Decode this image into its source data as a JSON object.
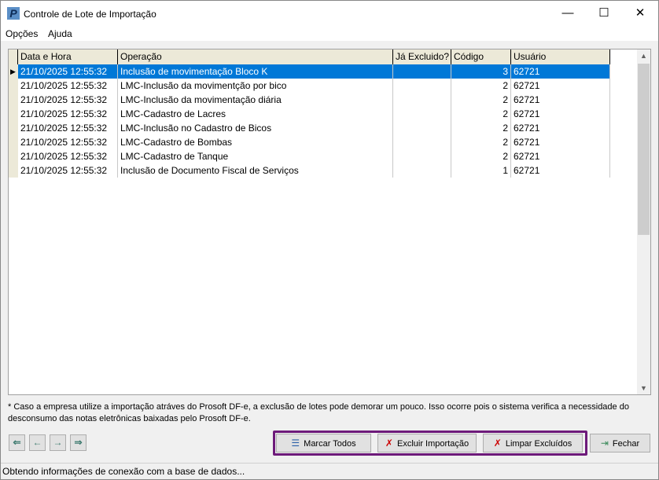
{
  "window": {
    "title": "Controle de Lote de Importação",
    "minimize": "—",
    "maximize": "☐",
    "close": "✕"
  },
  "menu": [
    "Opções",
    "Ajuda"
  ],
  "table": {
    "columns": [
      "Data e Hora",
      "Operação",
      "Já Excluido?",
      "Código",
      "Usuário"
    ],
    "rows": [
      {
        "data": "21/10/2025 12:55:32",
        "operacao": "Inclusão de movimentação Bloco K",
        "excluido": "",
        "codigo": "3",
        "usuario": "62721",
        "selected": true
      },
      {
        "data": "21/10/2025 12:55:32",
        "operacao": "LMC-Inclusão da movimentção por bico",
        "excluido": "",
        "codigo": "2",
        "usuario": "62721"
      },
      {
        "data": "21/10/2025 12:55:32",
        "operacao": "LMC-Inclusão da movimentação diária",
        "excluido": "",
        "codigo": "2",
        "usuario": "62721"
      },
      {
        "data": "21/10/2025 12:55:32",
        "operacao": "LMC-Cadastro de Lacres",
        "excluido": "",
        "codigo": "2",
        "usuario": "62721"
      },
      {
        "data": "21/10/2025 12:55:32",
        "operacao": "LMC-Inclusão no Cadastro de Bicos",
        "excluido": "",
        "codigo": "2",
        "usuario": "62721"
      },
      {
        "data": "21/10/2025 12:55:32",
        "operacao": "LMC-Cadastro de Bombas",
        "excluido": "",
        "codigo": "2",
        "usuario": "62721"
      },
      {
        "data": "21/10/2025 12:55:32",
        "operacao": "LMC-Cadastro de Tanque",
        "excluido": "",
        "codigo": "2",
        "usuario": "62721"
      },
      {
        "data": "21/10/2025 12:55:32",
        "operacao": "Inclusão de Documento Fiscal de Serviços",
        "excluido": "",
        "codigo": "1",
        "usuario": "62721"
      }
    ]
  },
  "note": "* Caso a empresa utilize a importação atráves do Prosoft DF-e, a exclusão de lotes pode demorar um pouco. Isso ocorre pois o sistema verifica a necessidade do desconsumo das notas eletrônicas baixadas pelo  Prosoft DF-e.",
  "buttons": {
    "marcar": "Marcar Todos",
    "excluir": "Excluir Importação",
    "limpar": "Limpar Excluídos",
    "fechar": "Fechar"
  },
  "status": "Obtendo informações de conexão com a base de dados...",
  "colors": {
    "selection": "#0078d7",
    "highlight_border": "#6d1a7a"
  }
}
